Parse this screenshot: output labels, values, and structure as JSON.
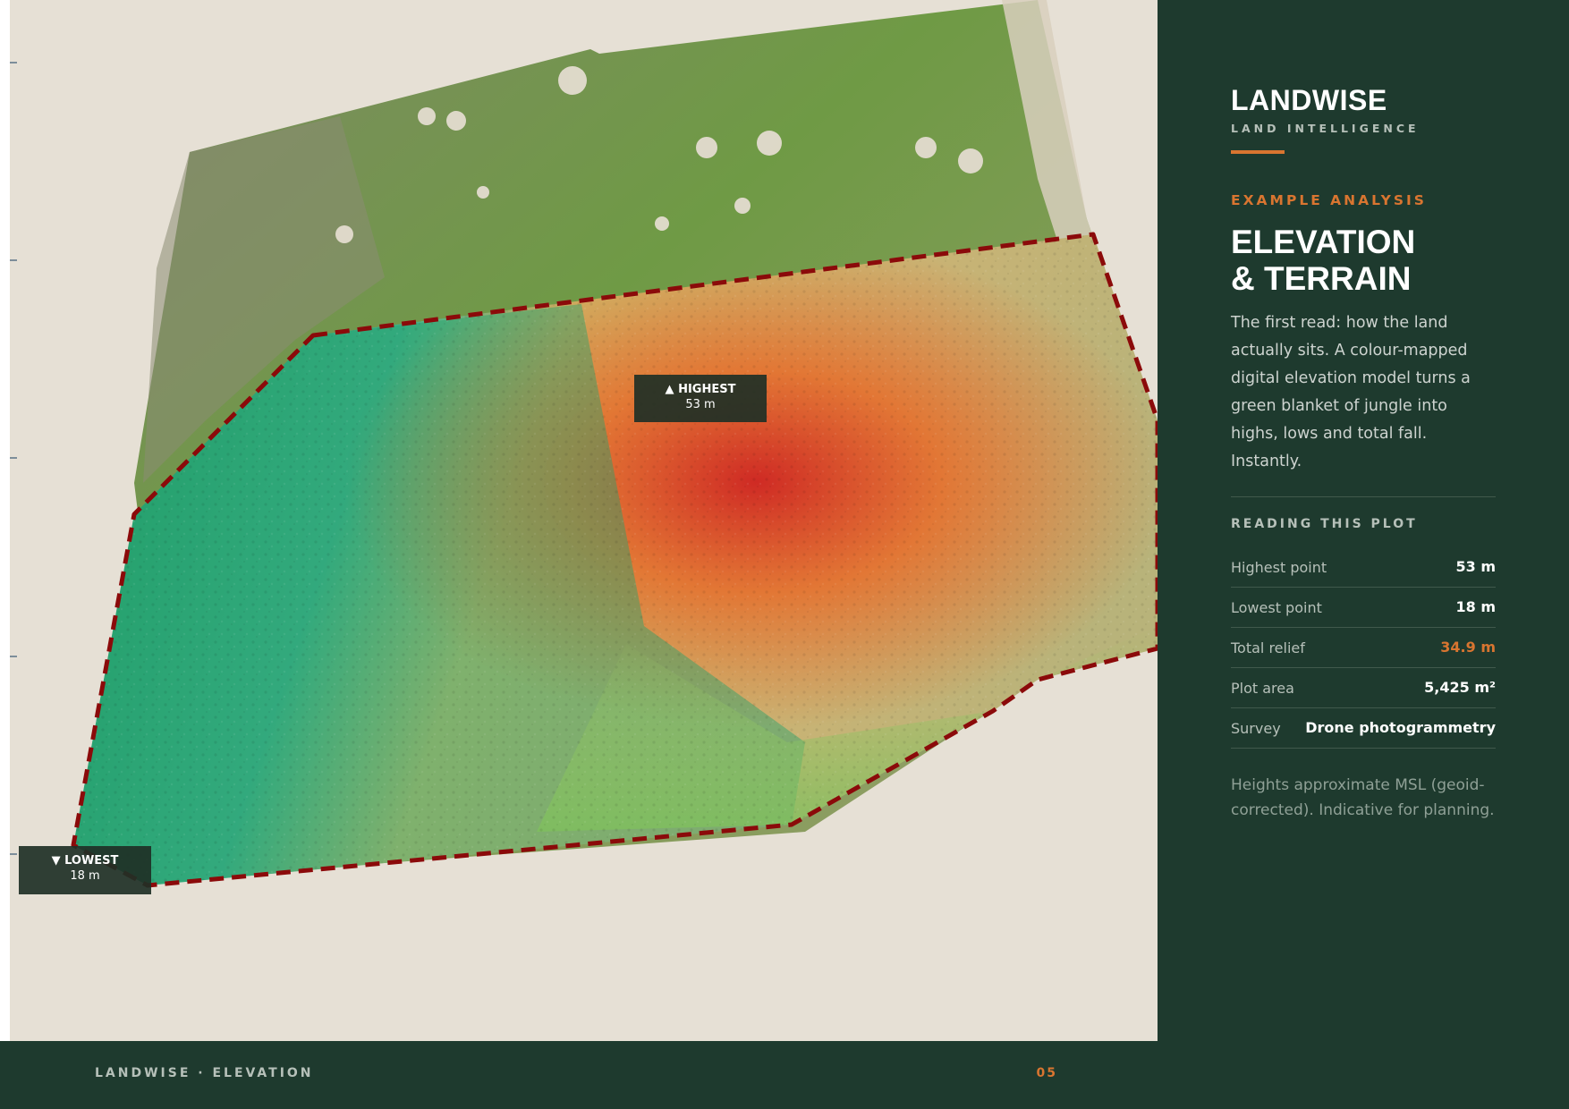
{
  "map": {
    "high_callout": {
      "line1": "▲ HIGHEST",
      "line2": "53 m"
    },
    "low_callout": {
      "line1": "▼ LOWEST",
      "line2": "18 m"
    },
    "colors": {
      "boundary": "#8b0a0a",
      "low_elevation": "#1fa36a",
      "mid_elevation": "#d9c06e",
      "high_elevation": "#d8302a",
      "vegetation": "#6f9a45"
    }
  },
  "panel": {
    "brand": "LANDWISE",
    "brand_sub": "LAND INTELLIGENCE",
    "eyebrow": "EXAMPLE ANALYSIS",
    "title_line1": "ELEVATION",
    "title_line2": "& TERRAIN",
    "description": "The first read: how the land actually sits. A colour-mapped digital elevation model turns a green blanket of jungle into highs, lows and total fall. Instantly.",
    "section_label": "READING THIS PLOT",
    "rows": [
      {
        "label": "Highest point",
        "value": "53 m"
      },
      {
        "label": "Lowest point",
        "value": "18 m"
      },
      {
        "label": "Total relief",
        "value": "34.9 m"
      },
      {
        "label": "Plot area",
        "value": "5,425 m²"
      },
      {
        "label": "Survey",
        "value": "Drone photogrammetry"
      }
    ],
    "footnote": "Heights approximate MSL (geoid-corrected). Indicative for planning.",
    "accent_color": "#d97530",
    "background_color": "#1e3a2e"
  },
  "footer": {
    "left": "LANDWISE · ELEVATION",
    "page_number": "05"
  }
}
